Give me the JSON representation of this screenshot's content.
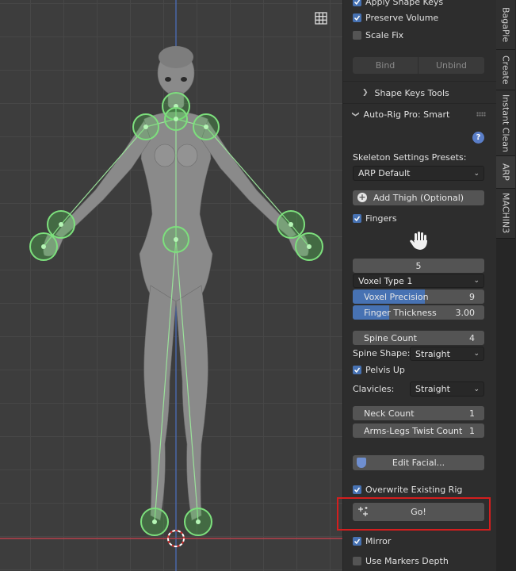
{
  "panel": {
    "apply_shape_keys": "Apply Shape Keys",
    "preserve_volume": "Preserve Volume",
    "scale_fix": "Scale Fix",
    "bind": "Bind",
    "unbind": "Unbind",
    "shape_keys_tools": "Shape Keys Tools",
    "auto_rig_header": "Auto-Rig Pro: Smart",
    "skeleton_presets_label": "Skeleton Settings Presets:",
    "preset_value": "ARP Default",
    "add_thigh": "Add Thigh (Optional)",
    "fingers": "Fingers",
    "finger_count": "5",
    "voxel_type": "Voxel Type 1",
    "voxel_precision_label": "Voxel Precision",
    "voxel_precision_value": "9",
    "voxel_precision_fraction": 0.55,
    "finger_thickness_label": "Finger Thickness",
    "finger_thickness_value": "3.00",
    "finger_thickness_fraction": 0.28,
    "spine_count_label": "Spine Count",
    "spine_count_value": "4",
    "spine_shape_label": "Spine Shape:",
    "spine_shape_value": "Straight",
    "pelvis_up": "Pelvis Up",
    "clavicles_label": "Clavicles:",
    "clavicles_value": "Straight",
    "neck_count_label": "Neck Count",
    "neck_count_value": "1",
    "twist_count_label": "Arms-Legs Twist Count",
    "twist_count_value": "1",
    "edit_facial": "Edit Facial...",
    "overwrite_rig": "Overwrite Existing Rig",
    "go": "Go!",
    "mirror": "Mirror",
    "use_markers_depth": "Use Markers Depth"
  },
  "tabs": [
    "BagaPie",
    "Create",
    "Instant Clean",
    "ARP",
    "MACHIN3"
  ],
  "active_tab": "ARP",
  "colors": {
    "accent_blue": "#4772b3",
    "marker_green": "#52d452",
    "highlight_red": "#d41e1e"
  }
}
